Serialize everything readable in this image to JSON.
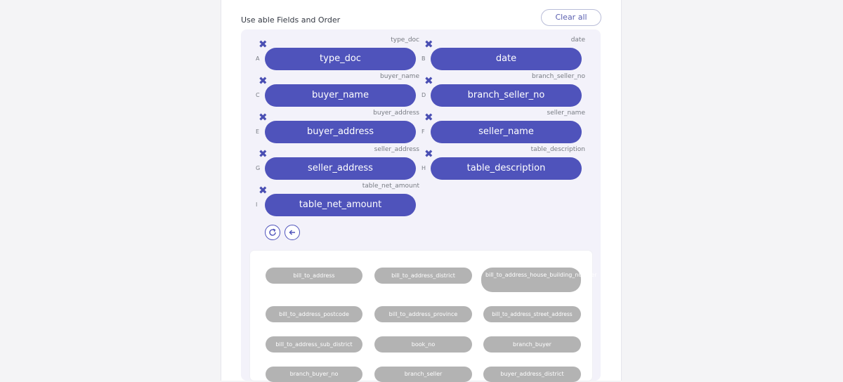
{
  "section_title": "Use able Fields and Order",
  "clear_button": "Clear all",
  "remove_glyph": "✖",
  "selected_fields": [
    {
      "letter": "A",
      "field": "type_doc"
    },
    {
      "letter": "B",
      "field": "date"
    },
    {
      "letter": "C",
      "field": "buyer_name"
    },
    {
      "letter": "D",
      "field": "branch_seller_no"
    },
    {
      "letter": "E",
      "field": "buyer_address"
    },
    {
      "letter": "F",
      "field": "seller_name"
    },
    {
      "letter": "G",
      "field": "seller_address"
    },
    {
      "letter": "H",
      "field": "table_description"
    },
    {
      "letter": "I",
      "field": "table_net_amount"
    }
  ],
  "available_fields": [
    "bill_to_address",
    "bill_to_address_district",
    "bill_to_address_house_building_number",
    "bill_to_address_postcode",
    "bill_to_address_province",
    "bill_to_address_street_address",
    "bill_to_address_sub_district",
    "book_no",
    "branch_buyer",
    "branch_buyer_no",
    "branch_seller",
    "buyer_address_district"
  ],
  "colors": {
    "accent": "#4f53bb",
    "chip": "#b3b3b3",
    "panel": "#f3f2fa"
  },
  "icons": [
    "remove-icon",
    "reset-icon",
    "back-arrow-icon"
  ]
}
